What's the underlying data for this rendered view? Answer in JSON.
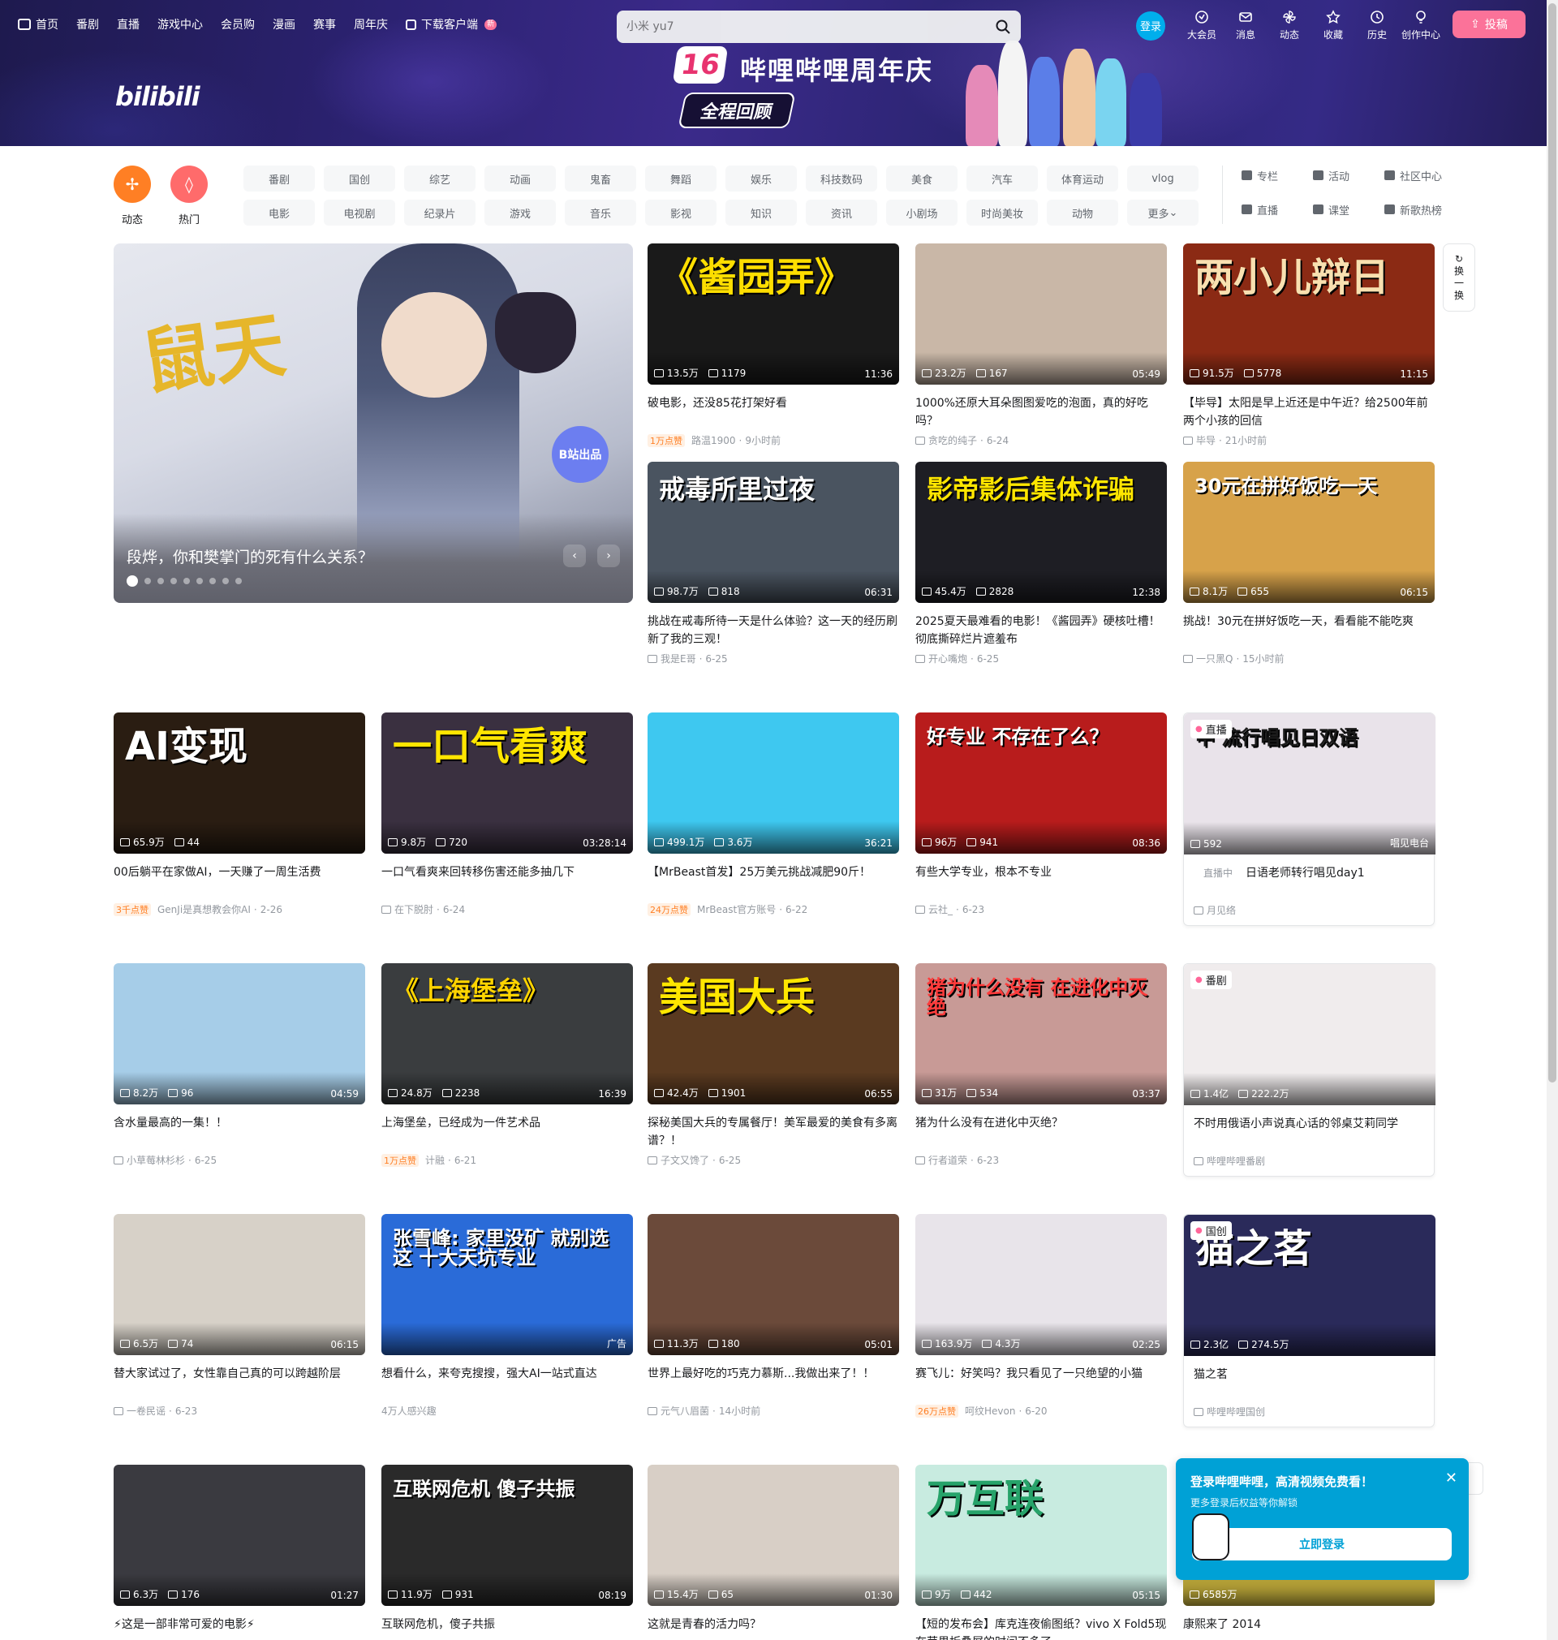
{
  "header": {
    "nav": [
      "首页",
      "番剧",
      "直播",
      "游戏中心",
      "会员购",
      "漫画",
      "赛事",
      "周年庆",
      "下载客户端"
    ],
    "new_badge": "新",
    "search_placeholder": "小米 yu7",
    "login": "登录",
    "right": [
      "大会员",
      "消息",
      "动态",
      "收藏",
      "历史",
      "创作中心"
    ],
    "upload": "投稿",
    "logo": "bilibili",
    "banner_num": "16",
    "banner_title": "哔哩哔哩周年庆",
    "banner_sub": "全程回顾"
  },
  "channels": {
    "big": [
      {
        "label": "动态",
        "color": "#ff7f24",
        "icon": "pinwheel-icon"
      },
      {
        "label": "热门",
        "color": "#ff6b6b",
        "icon": "flame-icon"
      }
    ],
    "grid": [
      "番剧",
      "国创",
      "综艺",
      "动画",
      "鬼畜",
      "舞蹈",
      "娱乐",
      "科技数码",
      "美食",
      "汽车",
      "体育运动",
      "vlog",
      "电影",
      "电视剧",
      "纪录片",
      "游戏",
      "音乐",
      "影视",
      "知识",
      "资讯",
      "小剧场",
      "时尚美妆",
      "动物",
      "更多"
    ],
    "links": [
      "专栏",
      "活动",
      "社区中心",
      "直播",
      "课堂",
      "新歌热榜"
    ]
  },
  "carousel": {
    "title": "段烨，你和樊掌门的死有什么关系？",
    "logo_text": "B站出品",
    "prev": "‹",
    "next": "›"
  },
  "refresh": [
    "换",
    "一",
    "换"
  ],
  "videos": [
    {
      "thumb_text": "《酱园弄》",
      "views": "13.5万",
      "danmaku": "1179",
      "duration": "11:36",
      "title": "破电影，还没85花打架好看",
      "hot": "1万点赞",
      "author": "路温1900",
      "date": "9小时前",
      "bg": "#1a1a1a",
      "fg": "#ffde00"
    },
    {
      "thumb_text": "",
      "views": "23.2万",
      "danmaku": "167",
      "duration": "05:49",
      "title": "1000%还原大耳朵图图爱吃的泡面，真的好吃吗？",
      "hot": "",
      "author": "贪吃的纯子",
      "date": "6-24",
      "bg": "#c9b7a7",
      "fg": "#ffffff"
    },
    {
      "thumb_text": "两小儿辩日",
      "views": "91.5万",
      "danmaku": "5778",
      "duration": "11:15",
      "title": "【毕导】太阳是早上近还是中午近？给2500年前两个小孩的回信",
      "hot": "",
      "author": "毕导",
      "date": "21小时前",
      "bg": "#8b2a14",
      "fg": "#f8e0b0"
    },
    {
      "thumb_text": "戒毒所里过夜",
      "views": "98.7万",
      "danmaku": "818",
      "duration": "06:31",
      "title": "挑战在戒毒所待一天是什么体验？这一天的经历刷新了我的三观！",
      "hot": "",
      "author": "我是E哥",
      "date": "6-25",
      "bg": "#4a5460",
      "fg": "#ffffff"
    },
    {
      "thumb_text": "影帝影后集体诈骗",
      "views": "45.4万",
      "danmaku": "2828",
      "duration": "12:38",
      "title": "2025夏天最难看的电影！《酱园弄》硬核吐槽！彻底撕碎烂片遮羞布",
      "hot": "",
      "author": "开心嘴炮",
      "date": "6-25",
      "bg": "#1e1e24",
      "fg": "#ffe600"
    },
    {
      "thumb_text": "30元在拼好饭吃一天",
      "views": "8.1万",
      "danmaku": "655",
      "duration": "06:15",
      "title": "挑战！30元在拼好饭吃一天，看看能不能吃爽",
      "hot": "",
      "author": "一只黑Q",
      "date": "15小时前",
      "bg": "#d7a24a",
      "fg": "#ffffff"
    },
    {
      "thumb_text": "AI变现",
      "views": "65.9万",
      "danmaku": "44",
      "duration": "",
      "title": "00后躺平在家做AI，一天赚了一周生活费",
      "hot": "3千点赞",
      "author": "GenJi是真想教会你AI",
      "date": "2-26",
      "bg": "#2a1d12",
      "fg": "#ffffff"
    },
    {
      "thumb_text": "一口气看爽",
      "views": "9.8万",
      "danmaku": "720",
      "duration": "03:28:14",
      "title": "一口气看爽来回转移伤害还能多抽几下",
      "hot": "",
      "author": "在下脱肘",
      "date": "6-24",
      "bg": "#3a3040",
      "fg": "#ffe600"
    },
    {
      "thumb_text": "",
      "views": "499.1万",
      "danmaku": "3.6万",
      "duration": "36:21",
      "title": "【MrBeast首发】25万美元挑战减肥90斤！",
      "hot": "24万点赞",
      "author": "MrBeast官方账号",
      "date": "6-22",
      "bg": "#3ec8f0",
      "fg": "#ffffff"
    },
    {
      "thumb_text": "好专业 不存在了么？",
      "views": "96万",
      "danmaku": "941",
      "duration": "08:36",
      "title": "有些大学专业，根本不专业",
      "hot": "",
      "author": "云社_",
      "date": "6-23",
      "bg": "#b81c1c",
      "fg": "#ffffff"
    },
    {
      "thumb_text": "中 流行唱见日双语",
      "views": "592",
      "danmaku": "",
      "duration": "唱见电台",
      "title": "日语老师转行唱见day1",
      "hot": "",
      "author": "月见络",
      "date": "",
      "bg": "#e9e3ea",
      "fg": "#1a1a1a",
      "tag": "直播",
      "live": "直播中"
    },
    {
      "thumb_text": "",
      "views": "8.2万",
      "danmaku": "96",
      "duration": "04:59",
      "title": "含水量最高的一集！！",
      "hot": "",
      "author": "小草莓林杉杉",
      "date": "6-25",
      "bg": "#a6cde8",
      "fg": "#ffffff"
    },
    {
      "thumb_text": "《上海堡垒》",
      "views": "24.8万",
      "danmaku": "2238",
      "duration": "16:39",
      "title": "上海堡垒，已经成为一件艺术品",
      "hot": "1万点赞",
      "author": "计融",
      "date": "6-21",
      "bg": "#3a3d3f",
      "fg": "#ffd400"
    },
    {
      "thumb_text": "美国大兵",
      "views": "42.4万",
      "danmaku": "1901",
      "duration": "06:55",
      "title": "探秘美国大兵的专属餐厅！美军最爱的美食有多离谱？！",
      "hot": "",
      "author": "子文又馋了",
      "date": "6-25",
      "bg": "#5a3a20",
      "fg": "#ffe600"
    },
    {
      "thumb_text": "猪为什么没有 在进化中灭绝",
      "views": "31万",
      "danmaku": "534",
      "duration": "03:37",
      "title": "猪为什么没有在进化中灭绝？",
      "hot": "",
      "author": "行者道荣",
      "date": "6-23",
      "bg": "#c89a96",
      "fg": "#ff3b3b"
    },
    {
      "thumb_text": "",
      "views": "1.4亿",
      "danmaku": "222.2万",
      "duration": "",
      "title": "不时用俄语小声说真心话的邻桌艾莉同学",
      "hot": "",
      "author": "哔哩哔哩番剧",
      "date": "",
      "bg": "#f0eced",
      "fg": "#18191c",
      "tag": "番剧"
    },
    {
      "thumb_text": "",
      "views": "6.5万",
      "danmaku": "74",
      "duration": "06:15",
      "title": "替大家试过了，女性靠自己真的可以跨越阶层",
      "hot": "",
      "author": "一卷民谣",
      "date": "6-23",
      "bg": "#d7d1c8",
      "fg": "#ffffff"
    },
    {
      "thumb_text": "张雪峰: 家里没矿 就别选这 十大天坑专业",
      "views": "",
      "danmaku": "",
      "duration": "广告",
      "title": "想看什么，来夸克搜搜，强大AI一站式直达",
      "hot": "",
      "author": "4万人感兴趣",
      "date": "",
      "bg": "#2a6bd8",
      "fg": "#ffffff"
    },
    {
      "thumb_text": "",
      "views": "11.3万",
      "danmaku": "180",
      "duration": "05:01",
      "title": "世界上最好吃的巧克力慕斯...我做出来了！！",
      "hot": "",
      "author": "元气八眉菌",
      "date": "14小时前",
      "bg": "#6b4a3a",
      "fg": "#ffffff"
    },
    {
      "thumb_text": "",
      "views": "163.9万",
      "danmaku": "4.3万",
      "duration": "02:25",
      "title": "赛飞儿：好笑吗？我只看见了一只绝望的小猫",
      "hot": "26万点赞",
      "author": "呵纹Hevon",
      "date": "6-20",
      "bg": "#e8e4ea",
      "fg": "#ffffff"
    },
    {
      "thumb_text": "猫之茗",
      "views": "2.3亿",
      "danmaku": "274.5万",
      "duration": "",
      "title": "猫之茗",
      "hot": "",
      "author": "哔哩哔哩国创",
      "date": "",
      "bg": "#2a2a5a",
      "fg": "#ffffff",
      "tag": "国创"
    },
    {
      "thumb_text": "",
      "views": "6.3万",
      "danmaku": "176",
      "duration": "01:27",
      "title": "⚡这是一部非常可爱的电影⚡",
      "hot": "",
      "author": "",
      "date": "",
      "bg": "#3a3a40",
      "fg": "#ffffff"
    },
    {
      "thumb_text": "互联网危机 傻子共振",
      "views": "11.9万",
      "danmaku": "931",
      "duration": "08:19",
      "title": "互联网危机，傻子共振",
      "hot": "",
      "author": "",
      "date": "",
      "bg": "#2a2a2a",
      "fg": "#ffffff"
    },
    {
      "thumb_text": "",
      "views": "15.4万",
      "danmaku": "65",
      "duration": "01:30",
      "title": "这就是青春的活力吗？",
      "hot": "",
      "author": "",
      "date": "",
      "bg": "#d8cfc6",
      "fg": "#ffffff"
    },
    {
      "thumb_text": "万互联",
      "views": "9万",
      "danmaku": "442",
      "duration": "05:15",
      "title": "【短的发布会】库克连夜偷图纸？vivo X Fold5现在苹果折叠屏的时间不多了",
      "hot": "",
      "author": "",
      "date": "",
      "bg": "#c8ebe0",
      "fg": "#27a36a"
    },
    {
      "thumb_text": "",
      "views": "6585万",
      "danmaku": "",
      "duration": "",
      "title": "康熙来了 2014",
      "hot": "",
      "author": "",
      "date": "",
      "bg": "#f3d84a",
      "fg": "#ffffff"
    }
  ],
  "popup": {
    "title": "登录哔哩哔哩，高清视频免费看！",
    "sub": "更多登录后权益等你解锁",
    "button": "立即登录",
    "close": "✕"
  }
}
